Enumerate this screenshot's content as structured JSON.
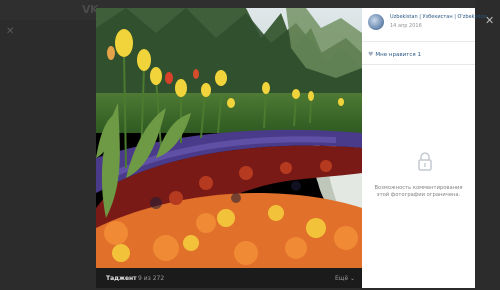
{
  "background": {
    "logo_text": "VK",
    "close_glyph": "✕"
  },
  "viewer": {
    "album_name": "Таджент",
    "counter": "9 из 272",
    "more_label": "Ещё ⌄",
    "close_glyph": "✕"
  },
  "panel": {
    "author": "Uzbekistan | Узбекистан | O'zbekiston",
    "date": "14 апр 2016",
    "like_label": "Мне нравится",
    "like_count": "1",
    "comments_note": "Возможность комментирования этой фотографии ограничена.",
    "icons": {
      "like": "heart-icon",
      "lock": "lock-icon"
    }
  },
  "colors": {
    "link": "#2a5885",
    "muted": "#828282",
    "overlay": "#2b2b2b"
  }
}
